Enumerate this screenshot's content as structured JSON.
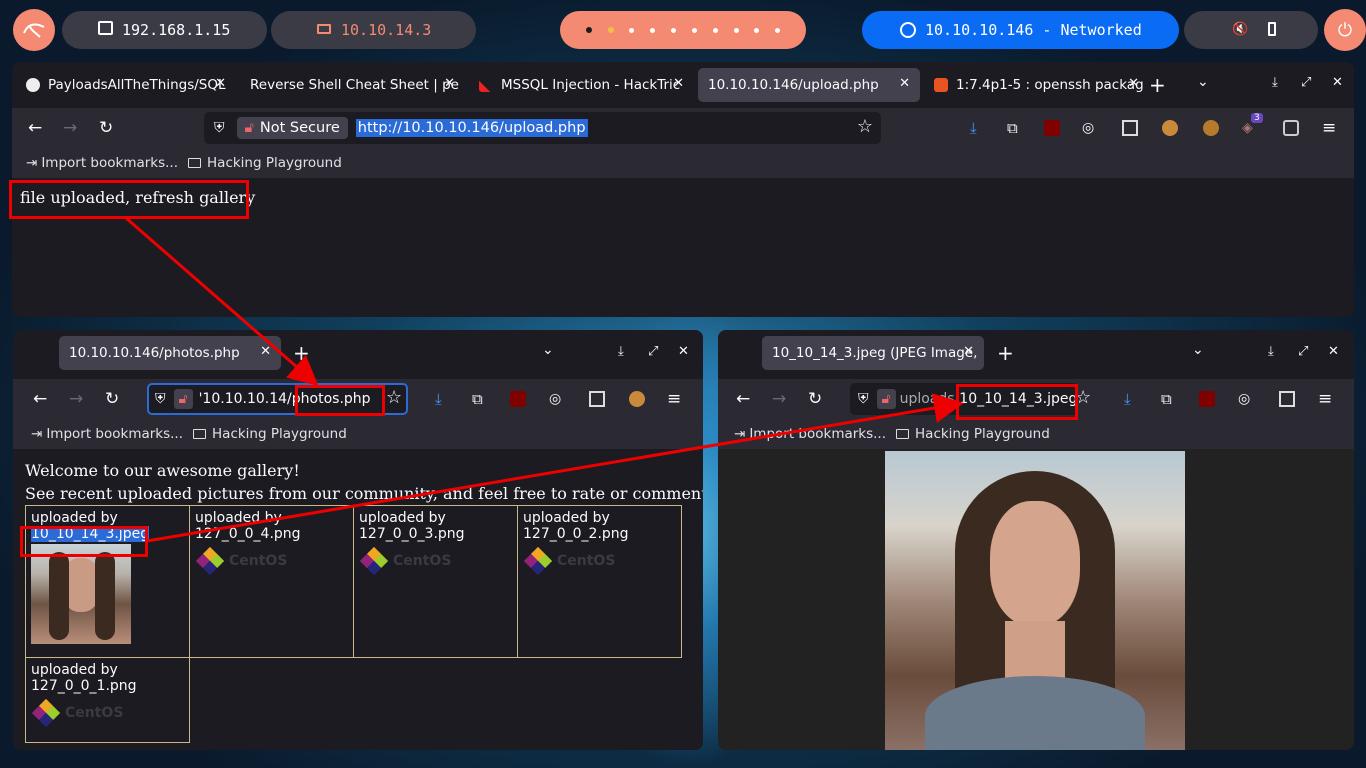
{
  "topbar": {
    "local_ip": "192.168.1.15",
    "vpn_ip": "10.10.14.3",
    "target": "10.10.10.146 - Networked"
  },
  "main_window": {
    "tabs": [
      {
        "label": "PayloadsAllTheThings/SQL"
      },
      {
        "label": "Reverse Shell Cheat Sheet | pe"
      },
      {
        "label": "MSSQL Injection - HackTric"
      },
      {
        "label": "10.10.10.146/upload.php"
      },
      {
        "label": "1:7.4p1-5 : openssh packag"
      }
    ],
    "security": "Not Secure",
    "url": "http://10.10.10.146/upload.php",
    "bookmarks": [
      "Import bookmarks...",
      "Hacking Playground"
    ],
    "content_text": "file uploaded, refresh gallery"
  },
  "left_window": {
    "tab": "10.10.10.146/photos.php",
    "url_prefix": "'10.10.10.14",
    "url_suffix": "/photos.php",
    "bookmarks": [
      "Import bookmarks...",
      "Hacking Playground"
    ],
    "welcome": "Welcome to our awesome gallery!",
    "subtitle": "See recent uploaded pictures from our community, and feel free to rate or comment",
    "cells": [
      {
        "by": "uploaded by",
        "file": "10_10_14_3.jpeg"
      },
      {
        "by": "uploaded by",
        "file": "127_0_0_4.png",
        "logo": "CentOS"
      },
      {
        "by": "uploaded by",
        "file": "127_0_0_3.png",
        "logo": "CentOS"
      },
      {
        "by": "uploaded by",
        "file": "127_0_0_2.png",
        "logo": "CentOS"
      },
      {
        "by": "uploaded by",
        "file": "127_0_0_1.png",
        "logo": "CentOS"
      }
    ]
  },
  "right_window": {
    "tab": "10_10_14_3.jpeg (JPEG Image,",
    "url_prefix": "uploads/",
    "url_suffix": "10_10_14_3.jpeg",
    "bookmarks": [
      "Import bookmarks...",
      "Hacking Playground"
    ]
  }
}
